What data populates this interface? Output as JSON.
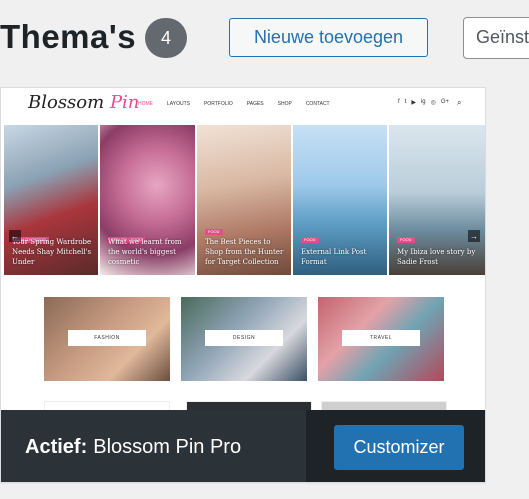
{
  "header": {
    "title": "Thema's",
    "count": "4",
    "add_button": "Nieuwe toevoegen",
    "installed_partial": "Geïnst"
  },
  "preview": {
    "logo_main": "Blossom",
    "logo_accent": "Pin",
    "menu": [
      "HOME",
      "LAYOUTS",
      "PORTFOLIO",
      "PAGES",
      "SHOP",
      "CONTACT"
    ],
    "social": [
      "f",
      "t",
      "▶",
      "ig",
      "◎",
      "G+"
    ],
    "slides": [
      {
        "tag": "BEAUTY · FOOD",
        "caption": "Your Spring Wardrobe Needs Shay Mitchell's Under"
      },
      {
        "tag": "BEAUTY · FOOD",
        "caption": "What we learnt from the world's biggest cosmetic"
      },
      {
        "tag": "FOOD",
        "caption": "The Best Pieces to Shop from the Hunter for Target Collection"
      },
      {
        "tag": "FOOD",
        "caption": "External Link Post Format"
      },
      {
        "tag": "FOOD",
        "caption": "My Ibiza love story by Sadie Frost"
      }
    ],
    "categories": [
      "FASHION",
      "DESIGN",
      "TRAVEL"
    ]
  },
  "active": {
    "label": "Actief:",
    "theme_name": "Blossom Pin Pro",
    "customize_button": "Customizer"
  },
  "colors": {
    "accent": "#2271b1",
    "brand_pink": "#e84a8a",
    "active_bar": "#1d2327"
  }
}
